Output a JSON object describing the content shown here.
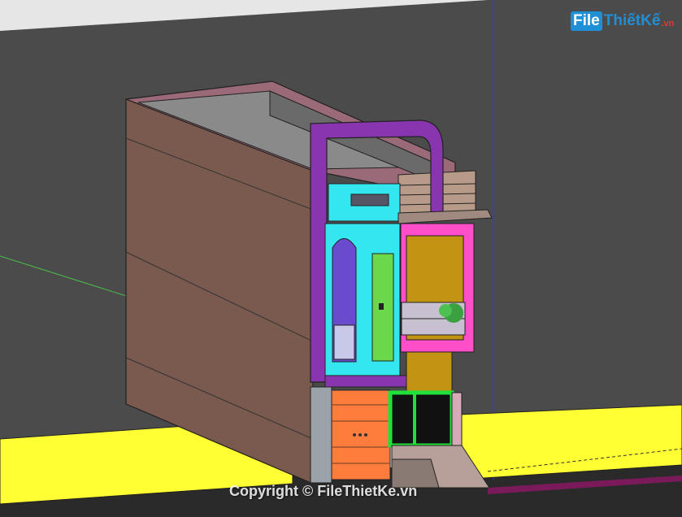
{
  "watermark": {
    "logo_box": "File",
    "logo_name": "ThiếtKế",
    "logo_tld": ".vn",
    "copyright": "Copyright © FileThietKe.vn"
  },
  "colors": {
    "sky": "#e6e6e6",
    "wall_dark": "#4b4b4b",
    "ground": "#2a2a2a",
    "fence": "#ffff33",
    "side_wall": "#7a5a4e",
    "roof_parapet": "#9a6a78",
    "frame_purple": "#8a35b0",
    "panel_cyan": "#33e6f0",
    "magenta": "#ff4fc8",
    "door_orange": "#ff7d3c",
    "gate_green": "#22e03a",
    "mustard": "#c39313"
  }
}
